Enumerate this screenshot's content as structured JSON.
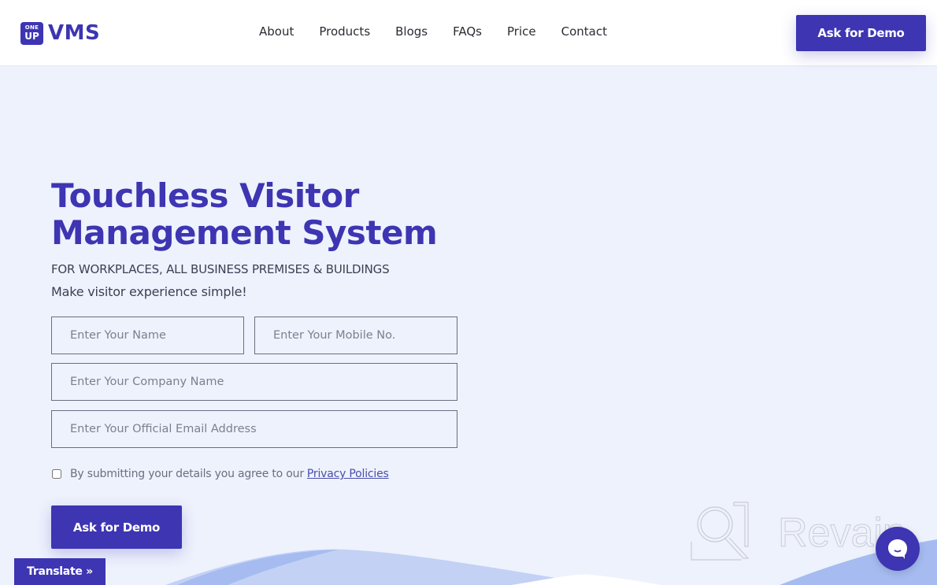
{
  "header": {
    "logo": {
      "badge_top": "ONE",
      "badge_bottom": "UP",
      "text": "VMS"
    },
    "nav": [
      "About",
      "Products",
      "Blogs",
      "FAQs",
      "Price",
      "Contact"
    ],
    "cta_label": "Ask for Demo"
  },
  "hero": {
    "title_line1": "Touchless Visitor",
    "title_line2": "Management System",
    "subtitle": "FOR WORKPLACES, ALL BUSINESS PREMISES & BUILDINGS",
    "tagline": "Make visitor experience simple!"
  },
  "form": {
    "name_placeholder": "Enter Your Name",
    "mobile_placeholder": "Enter Your Mobile No.",
    "company_placeholder": "Enter Your Company Name",
    "email_placeholder": "Enter Your Official Email Address",
    "consent_text": "By submitting your details you agree to our",
    "consent_link": "Privacy Policies",
    "consent_checked": false,
    "submit_label": "Ask for Demo"
  },
  "translate_label": "Translate »",
  "watermark_text": "Revain",
  "colors": {
    "brand": "#3d35b2",
    "background": "#eef2fd",
    "wave_light": "#c3d1f5",
    "wave_mid": "#a6bcf0"
  }
}
